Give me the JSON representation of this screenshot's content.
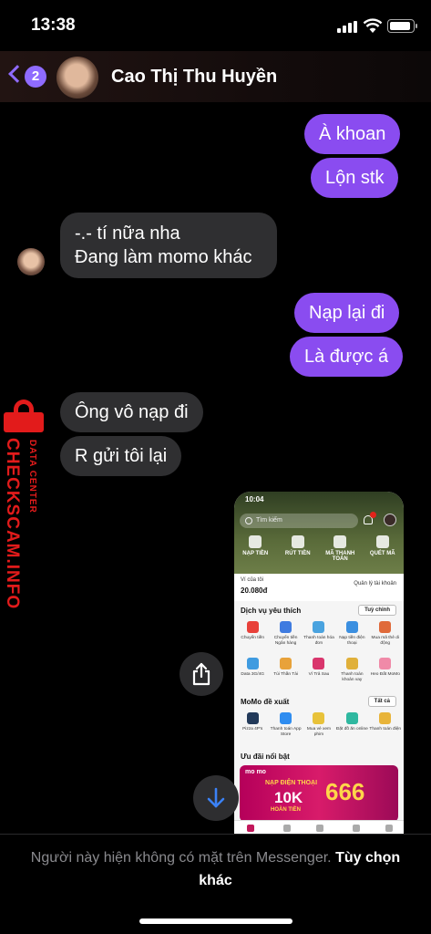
{
  "status_bar": {
    "time": "13:38"
  },
  "header": {
    "back_count": "2",
    "contact_name": "Cao Thị Thu Huyền"
  },
  "messages": {
    "out_1": "À khoan",
    "out_2": "Lộn stk",
    "in_1_line1": "-.- tí nữa nha",
    "in_1_line2": "Đang làm momo khác",
    "out_3": "Nạp lại đi",
    "out_4": "Là được á",
    "in_2": "Ông vô nạp đi",
    "in_3": "R gửi tôi lại"
  },
  "watermark": {
    "big_text": "CHECKSCAM.INFO",
    "small_text": "DATA CENTER"
  },
  "shared_image": {
    "time": "10:04",
    "search_placeholder": "Tìm kiếm",
    "actions": [
      "NẠP TIỀN",
      "RÚT TIỀN",
      "MÃ THANH TOÁN",
      "QUÉT MÃ"
    ],
    "wallet_label": "Ví của tôi",
    "wallet_balance": "20.080đ",
    "account_manage": "Quản lý tài khoản",
    "fav_title": "Dịch vụ yêu thích",
    "fav_button": "Tuỳ chỉnh",
    "fav_row1": [
      "Chuyển tiền",
      "Chuyển tiền Ngân hàng",
      "Thanh toán hóa đơn",
      "Nạp tiền điện thoại",
      "Mua mã thẻ di động"
    ],
    "fav_row2": [
      "Data 3G/4G",
      "Túi Thần Tài",
      "Ví Trả Sau",
      "Thanh toán khoản vay",
      "Heo Đất MoMo"
    ],
    "suggest_title": "MoMo đề xuất",
    "suggest_button": "Tất cả",
    "suggest_row": [
      "Pizza 4P's",
      "Thanh toán App Store",
      "Mua vé xem phim",
      "Đặt đồ ăn online",
      "Thanh toán điện"
    ],
    "deals_title": "Ưu đãi nổi bật",
    "banner_logo": "mo mo",
    "banner_line1": "NẠP ĐIỆN THOẠI",
    "banner_amount": "10K",
    "banner_line2": "HOÀN TIỀN",
    "banner_big": "666"
  },
  "footer": {
    "notice": "Người này hiện không có mặt trên Messenger.",
    "link": "Tùy chọn khác"
  },
  "colors": {
    "outgoing_bubble": "#8a4cf0",
    "incoming_bubble": "#2f2f31",
    "accent": "#8f6bff",
    "watermark": "#e21b1b"
  }
}
